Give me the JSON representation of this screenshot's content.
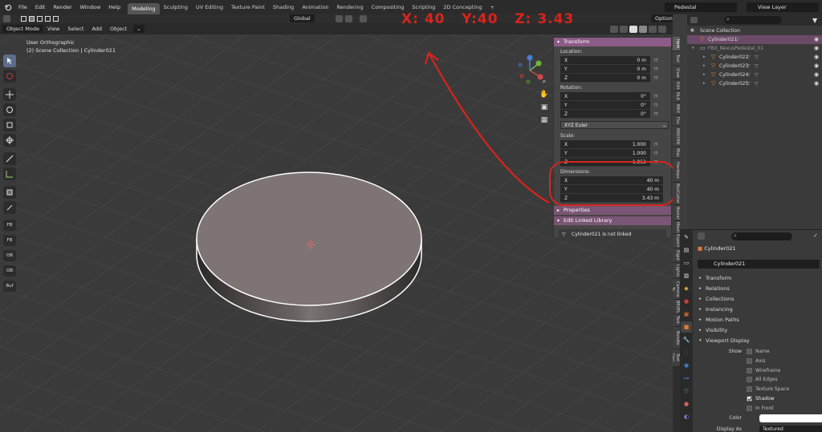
{
  "topbar": {
    "menus": [
      "File",
      "Edit",
      "Render",
      "Window",
      "Help"
    ],
    "workspaces": [
      "Modeling",
      "Sculpting",
      "UV Editing",
      "Texture Paint",
      "Shading",
      "Animation",
      "Rendering",
      "Compositing",
      "Scripting",
      "2D Concepting",
      "+"
    ],
    "active_workspace": "Modeling",
    "scene": "Pedestal",
    "view_layer": "View Layer"
  },
  "viewport": {
    "mode": "Object Mode",
    "menus": [
      "View",
      "Select",
      "Add",
      "Object"
    ],
    "transform_orientation": "Global",
    "options_label": "Options",
    "view_name": "User Orthographic",
    "collection_info": "(2) Scene Collection | Cylinder021"
  },
  "annotation": "X: 40   Y:40   Z: 3.43",
  "toolbar": {
    "buttons": [
      "select-box",
      "cursor",
      "move",
      "rotate",
      "scale",
      "transform",
      "annotate",
      "measure",
      "add-cube",
      "extrude",
      "inset"
    ],
    "script_buttons": [
      "FB",
      "FB",
      "OB",
      "OB",
      "Buf"
    ]
  },
  "npanel": {
    "transform_header": "Transform",
    "location_label": "Location:",
    "location": [
      {
        "axis": "X",
        "value": "0 m"
      },
      {
        "axis": "Y",
        "value": "0 m"
      },
      {
        "axis": "Z",
        "value": "0 m"
      }
    ],
    "rotation_label": "Rotation:",
    "rotation": [
      {
        "axis": "X",
        "value": "0°"
      },
      {
        "axis": "Y",
        "value": "0°"
      },
      {
        "axis": "Z",
        "value": "0°"
      }
    ],
    "rotation_mode": "XYZ Euler",
    "scale_label": "Scale:",
    "scale": [
      {
        "axis": "X",
        "value": "1.000"
      },
      {
        "axis": "Y",
        "value": "1.000"
      },
      {
        "axis": "Z",
        "value": "1.852"
      }
    ],
    "dimensions_label": "Dimensions:",
    "dimensions": [
      {
        "axis": "X",
        "value": "40 m"
      },
      {
        "axis": "Y",
        "value": "40 m"
      },
      {
        "axis": "Z",
        "value": "3.43 m"
      }
    ],
    "properties_header": "Properties",
    "linked_header": "Edit Linked Library",
    "linked_note": "Cylinder021 is not linked"
  },
  "vtabs": [
    "Item",
    "Tool",
    "View",
    "Edit",
    "NLA",
    "MKX",
    "Fbx",
    "MACHIN",
    "Misc",
    "Hardops",
    "BoxCutter",
    "Bezier",
    "Mesh",
    "Export",
    "Rigid",
    "Lights",
    "Camera To",
    "BEVEL",
    "Text",
    "Bundle",
    "Text Gen"
  ],
  "outliner": {
    "root": "Scene Collection",
    "items": [
      {
        "name": "Cylinder021",
        "selected": true,
        "indent": 1
      },
      {
        "name": "FBX_NexusPedestal_01",
        "selected": false,
        "indent": 1
      },
      {
        "name": "Cylinder022",
        "selected": false,
        "indent": 2
      },
      {
        "name": "Cylinder023",
        "selected": false,
        "indent": 2
      },
      {
        "name": "Cylinder024",
        "selected": false,
        "indent": 2
      },
      {
        "name": "Cylinder025",
        "selected": false,
        "indent": 2
      }
    ]
  },
  "properties": {
    "object_name": "Cylinder021",
    "object_field": "Cylinder021",
    "sections": [
      "Transform",
      "Relations",
      "Collections",
      "Instancing",
      "Motion Paths",
      "Visibility",
      "Viewport Display"
    ],
    "viewport_display": {
      "show_label": "Show",
      "options": [
        {
          "label": "Name",
          "checked": false
        },
        {
          "label": "Axis",
          "checked": false
        },
        {
          "label": "Wireframe",
          "checked": false
        },
        {
          "label": "All Edges",
          "checked": false
        },
        {
          "label": "Texture Space",
          "checked": false
        },
        {
          "label": "Shadow",
          "checked": true
        },
        {
          "label": "In Front",
          "checked": false
        }
      ],
      "color_label": "Color",
      "color_value": "#ffffff",
      "display_as_label": "Display As",
      "display_as": "Textured"
    }
  },
  "colors": {
    "panel_header": "#8d5b87",
    "annotation": "#d9231c",
    "selection": "#6b4a68",
    "cylinder_top": "#7d7473"
  }
}
